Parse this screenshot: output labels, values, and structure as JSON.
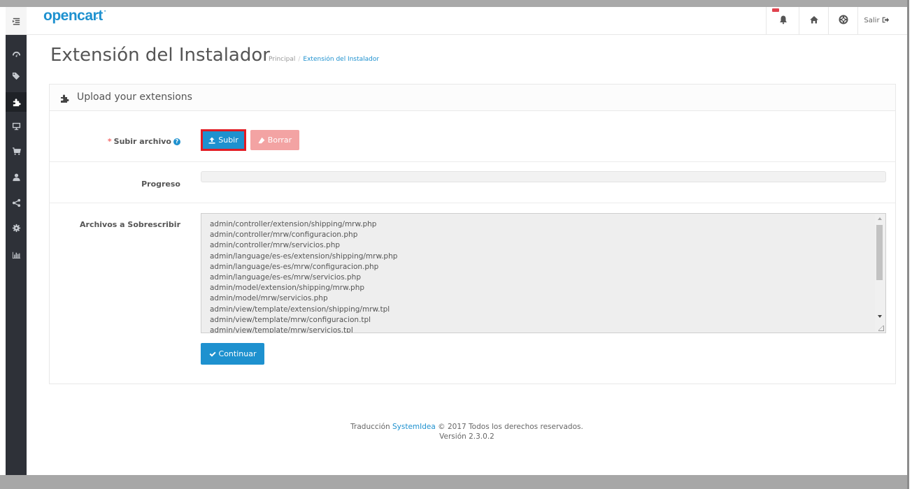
{
  "colors": {
    "accent": "#1e91cf",
    "danger_light": "#f3a3a3",
    "sidebar_bg": "#2e3138",
    "highlight_border": "#e31b23"
  },
  "header": {
    "logo_text": "opencart",
    "logout_label": "Salir",
    "icons": [
      "bell-icon",
      "home-icon",
      "life-ring-icon",
      "sign-out-icon"
    ]
  },
  "sidebar": {
    "items": [
      {
        "icon": "menu-toggle-icon"
      },
      {
        "icon": "dashboard-icon"
      },
      {
        "icon": "tags-icon"
      },
      {
        "icon": "puzzle-piece-icon",
        "active": true
      },
      {
        "icon": "desktop-icon"
      },
      {
        "icon": "shopping-cart-icon"
      },
      {
        "icon": "user-icon"
      },
      {
        "icon": "share-alt-icon"
      },
      {
        "icon": "cog-icon"
      },
      {
        "icon": "bar-chart-icon"
      }
    ]
  },
  "page": {
    "title": "Extensión del Instalador",
    "breadcrumb": [
      "Principal",
      "Extensión del Instalador"
    ]
  },
  "panel": {
    "heading": "Upload your extensions",
    "upload_label": "Subir archivo",
    "upload_button": "Subir",
    "clear_button": "Borrar",
    "progress_label": "Progreso",
    "progress_value": 0,
    "overwrite_label": "Archivos a Sobrescribir",
    "overwrite_files": [
      "admin/controller/extension/shipping/mrw.php",
      "admin/controller/mrw/configuracion.php",
      "admin/controller/mrw/servicios.php",
      "admin/language/es-es/extension/shipping/mrw.php",
      "admin/language/es-es/mrw/configuracion.php",
      "admin/language/es-es/mrw/servicios.php",
      "admin/model/extension/shipping/mrw.php",
      "admin/model/mrw/servicios.php",
      "admin/view/template/extension/shipping/mrw.tpl",
      "admin/view/template/mrw/configuracion.tpl",
      "admin/view/template/mrw/servicios.tpl"
    ],
    "continue_button": "Continuar"
  },
  "footer": {
    "prefix": "Traducción",
    "link": "SystemIdea",
    "suffix": "© 2017 Todos los derechos reservados.",
    "version": "Versión 2.3.0.2"
  }
}
